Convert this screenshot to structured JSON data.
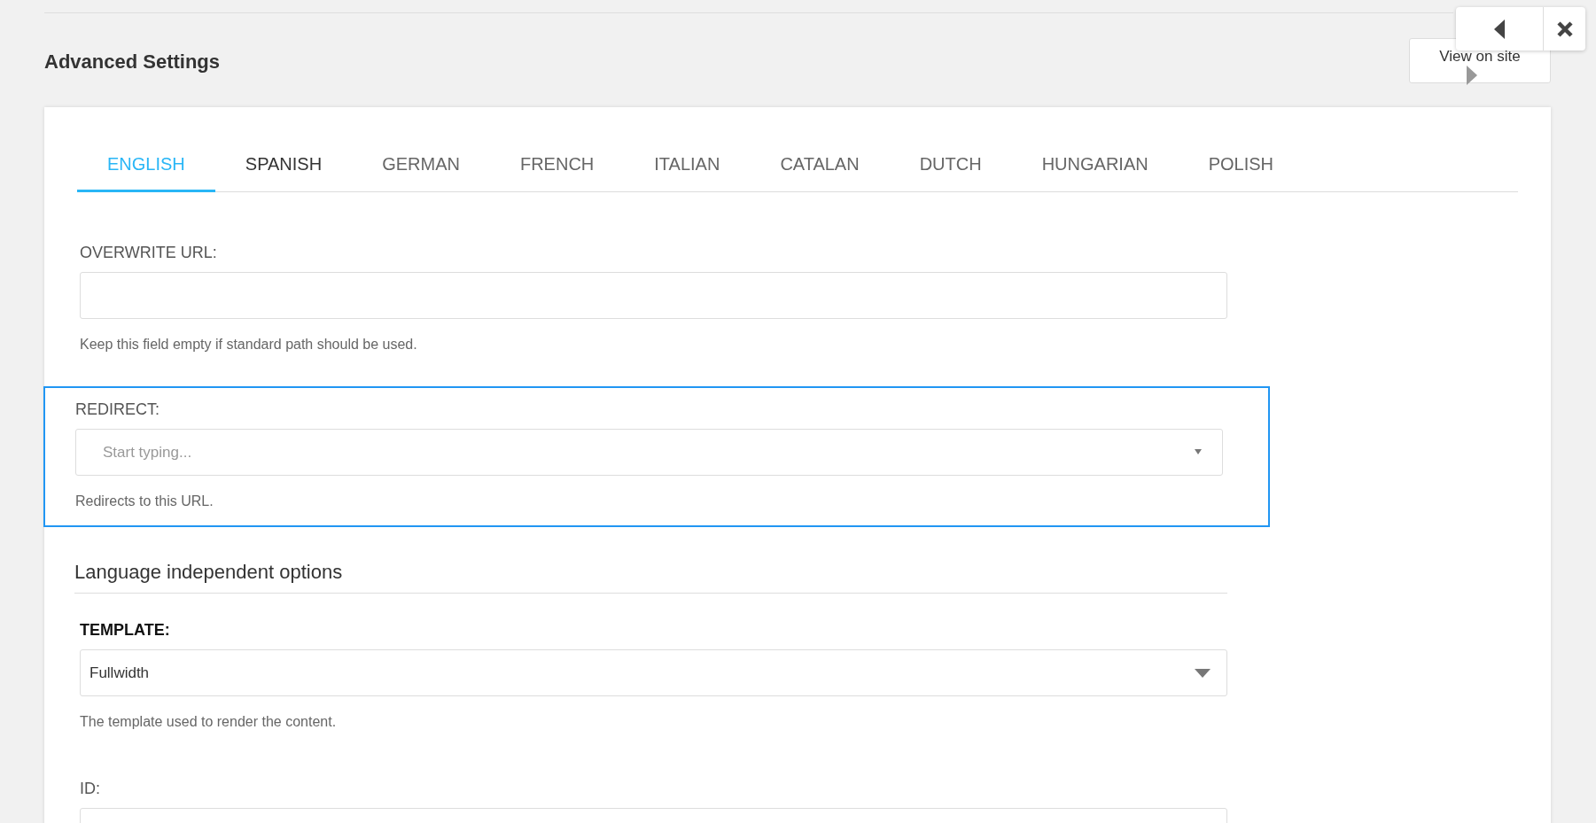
{
  "page": {
    "title": "Advanced Settings",
    "view_button": "View on site"
  },
  "toolbar": {
    "buttons": [
      {
        "kind": "back"
      },
      {
        "kind": "close"
      }
    ]
  },
  "tabs": [
    {
      "label": "ENGLISH",
      "selected": true
    },
    {
      "label": "SPANISH",
      "selected": false
    },
    {
      "label": "GERMAN",
      "selected": false
    },
    {
      "label": "FRENCH",
      "selected": false
    },
    {
      "label": "ITALIAN",
      "selected": false
    },
    {
      "label": "CATALAN",
      "selected": false
    },
    {
      "label": "DUTCH",
      "selected": false
    },
    {
      "label": "HUNGARIAN",
      "selected": false
    },
    {
      "label": "POLISH",
      "selected": false
    }
  ],
  "language_fields": [
    {
      "kind": "text",
      "label": "OVERWRITE URL:",
      "bold_label": false,
      "highlighted": false,
      "help": "Keep this field empty if standard path should be used."
    },
    {
      "kind": "autocomplete",
      "label": "REDIRECT:",
      "bold_label": false,
      "highlighted": true,
      "placeholder": "Start typing...",
      "help": "Redirects to this URL."
    }
  ],
  "section": {
    "title": "Language independent options"
  },
  "common_fields": [
    {
      "kind": "select",
      "label": "TEMPLATE:",
      "bold_label": true,
      "highlighted": false,
      "value": "Fullwidth",
      "help": "The template used to render the content."
    },
    {
      "kind": "text",
      "label": "ID:",
      "bold_label": false,
      "highlighted": false
    }
  ]
}
